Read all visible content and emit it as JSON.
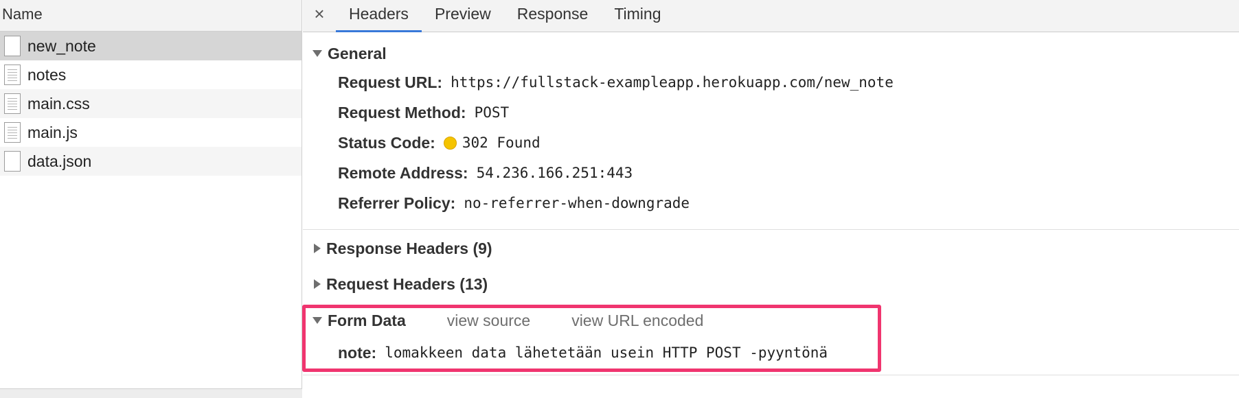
{
  "left_panel": {
    "header": "Name",
    "files": [
      {
        "name": "new_note",
        "icon": "blank-file-icon",
        "selected": true
      },
      {
        "name": "notes",
        "icon": "document-file-icon"
      },
      {
        "name": "main.css",
        "icon": "document-file-icon"
      },
      {
        "name": "main.js",
        "icon": "document-file-icon"
      },
      {
        "name": "data.json",
        "icon": "blank-file-icon"
      }
    ]
  },
  "tabs": {
    "close": "×",
    "items": [
      "Headers",
      "Preview",
      "Response",
      "Timing"
    ],
    "active": "Headers",
    "accent": "#3879d9"
  },
  "general": {
    "title": "General",
    "request_url": {
      "key": "Request URL:",
      "value": "https://fullstack-exampleapp.herokuapp.com/new_note"
    },
    "request_method": {
      "key": "Request Method:",
      "value": "POST"
    },
    "status_code": {
      "key": "Status Code:",
      "value": "302 Found",
      "status_color": "#f5c400"
    },
    "remote_address": {
      "key": "Remote Address:",
      "value": "54.236.166.251:443"
    },
    "referrer_policy": {
      "key": "Referrer Policy:",
      "value": "no-referrer-when-downgrade"
    }
  },
  "response_headers": {
    "title": "Response Headers (9)"
  },
  "request_headers": {
    "title": "Request Headers (13)"
  },
  "form_data": {
    "title": "Form Data",
    "view_source": "view source",
    "view_url_encoded": "view URL encoded",
    "note_key": "note:",
    "note_value": "lomakkeen data lähetetään usein HTTP POST -pyyntönä",
    "highlight_color": "#f0356f"
  }
}
